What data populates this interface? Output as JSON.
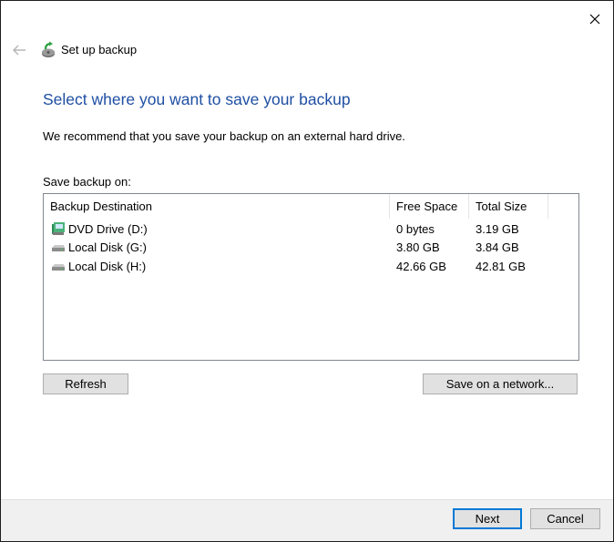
{
  "window": {
    "title": "Set up backup"
  },
  "main": {
    "heading": "Select where you want to save your backup",
    "description": "We recommend that you save your backup on an external hard drive.",
    "save_label": "Save backup on:"
  },
  "list": {
    "columns": [
      "Backup Destination",
      "Free Space",
      "Total Size"
    ],
    "rows": [
      {
        "icon": "dvd-drive-icon",
        "name": "DVD Drive (D:)",
        "free": "0 bytes",
        "total": "3.19 GB"
      },
      {
        "icon": "hard-disk-icon",
        "name": "Local Disk (G:)",
        "free": "3.80 GB",
        "total": "3.84 GB"
      },
      {
        "icon": "hard-disk-icon",
        "name": "Local Disk (H:)",
        "free": "42.66 GB",
        "total": "42.81 GB"
      }
    ]
  },
  "buttons": {
    "refresh": "Refresh",
    "network": "Save on a network...",
    "next": "Next",
    "cancel": "Cancel"
  },
  "colors": {
    "heading": "#1f4fa3",
    "default_button_border": "#0078d7"
  }
}
